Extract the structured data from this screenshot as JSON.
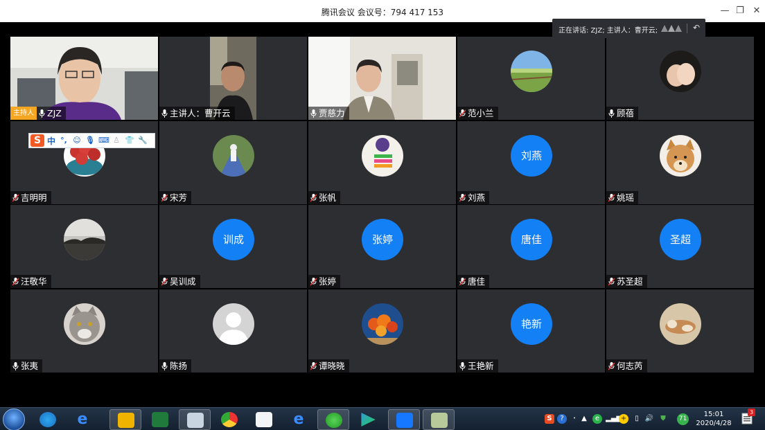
{
  "window": {
    "title": "腾讯会议  会议号：794 417 153"
  },
  "speaker_bar": {
    "text": "正在讲话: ZJZ; 主讲人：曹开云;"
  },
  "host_badge": "主持人",
  "participants": [
    {
      "name": "ZJZ"
    },
    {
      "name": "主讲人：曹开云"
    },
    {
      "name": "贾慈力"
    },
    {
      "name": "范小兰"
    },
    {
      "name": "顾蓓"
    },
    {
      "name": "吉明明"
    },
    {
      "name": "宋芳"
    },
    {
      "name": "张帆"
    },
    {
      "name": "刘燕",
      "avatar_text": "刘燕"
    },
    {
      "name": "姚瑶"
    },
    {
      "name": "汪敬华"
    },
    {
      "name": "吴训成",
      "avatar_text": "训成"
    },
    {
      "name": "张婷",
      "avatar_text": "张婷"
    },
    {
      "name": "唐佳",
      "avatar_text": "唐佳"
    },
    {
      "name": "苏圣超",
      "avatar_text": "圣超"
    },
    {
      "name": "张夷"
    },
    {
      "name": "陈扬"
    },
    {
      "name": "谭晓晓"
    },
    {
      "name": "王艳新",
      "avatar_text": "艳新"
    },
    {
      "name": "何志芮"
    }
  ],
  "ime": {
    "logo": "S",
    "mode": "中"
  },
  "taskbar": {
    "time": "15:01",
    "date": "2020/4/28",
    "notification_count": "3",
    "battery_badge": "71"
  },
  "colors": {
    "avatar_blue": "#1480f5",
    "tile_bg": "#2d2e32",
    "host_badge": "#f5a623"
  }
}
